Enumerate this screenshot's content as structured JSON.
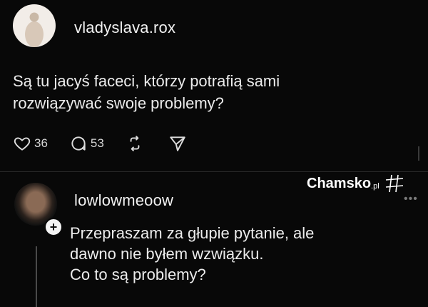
{
  "post": {
    "username": "vladyslava.rox",
    "text_line1": "Są tu jacyś faceci, którzy potrafią sami",
    "text_line2": "rozwiązywać swoje problemy?",
    "likes": "36",
    "comments": "53"
  },
  "reply": {
    "username": "lowlowmeoow",
    "line1": "Przepraszam za głupie pytanie, ale",
    "line2": "dawno nie byłem wzwiązku.",
    "line3": "Co to są problemy?"
  },
  "watermark": {
    "brand": "Chamsko",
    "suffix": ".pl"
  },
  "icons": {
    "like": "heart-icon",
    "comment": "comment-icon",
    "repost": "repost-icon",
    "share": "send-icon",
    "follow": "plus-icon",
    "more": "more-icon"
  },
  "colors": {
    "background": "#080808",
    "text": "#ececec"
  }
}
